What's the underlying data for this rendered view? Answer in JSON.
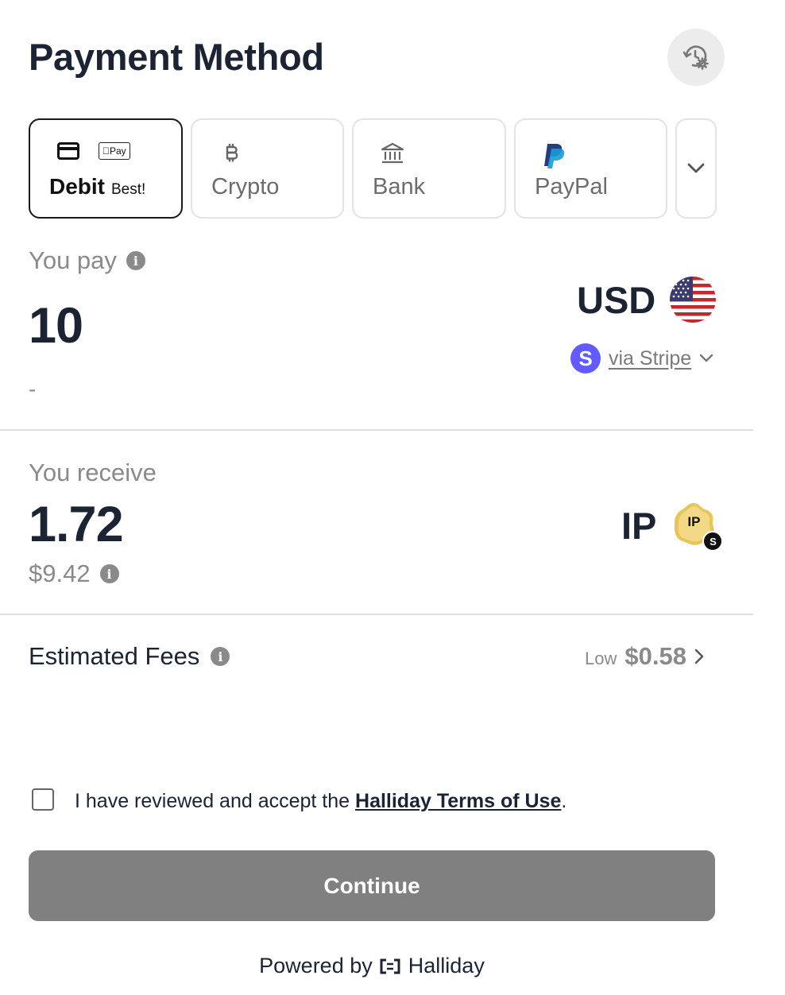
{
  "header": {
    "title": "Payment Method"
  },
  "methods": [
    {
      "label": "Debit",
      "badge": "Best!",
      "icons": [
        "card-icon",
        "apple-pay-icon"
      ],
      "selected": true
    },
    {
      "label": "Crypto",
      "icons": [
        "bitcoin-icon"
      ]
    },
    {
      "label": "Bank",
      "icons": [
        "bank-icon"
      ]
    },
    {
      "label": "PayPal",
      "icons": [
        "paypal-icon"
      ]
    }
  ],
  "apple_pay_text": "Pay",
  "pay": {
    "label": "You pay",
    "amount": "10",
    "sub_value": "-",
    "currency": "USD",
    "provider": "via Stripe",
    "provider_logo": "S"
  },
  "receive": {
    "label": "You receive",
    "amount": "1.72",
    "usd_value": "$9.42",
    "token": "IP",
    "token_logo": "IP",
    "token_badge": "S"
  },
  "fees": {
    "label": "Estimated Fees",
    "level": "Low",
    "amount": "$0.58"
  },
  "terms": {
    "prefix": "I have reviewed and accept the ",
    "link": "Halliday Terms of Use",
    "suffix": ".",
    "checked": false
  },
  "continue_label": "Continue",
  "footer": {
    "prefix": "Powered by",
    "brand": "Halliday"
  },
  "colors": {
    "stripe": "#635bff",
    "continue_disabled": "#808080",
    "paypal_dark": "#253b80",
    "paypal_light": "#179bd7",
    "token_gold": "#e8c45c"
  }
}
